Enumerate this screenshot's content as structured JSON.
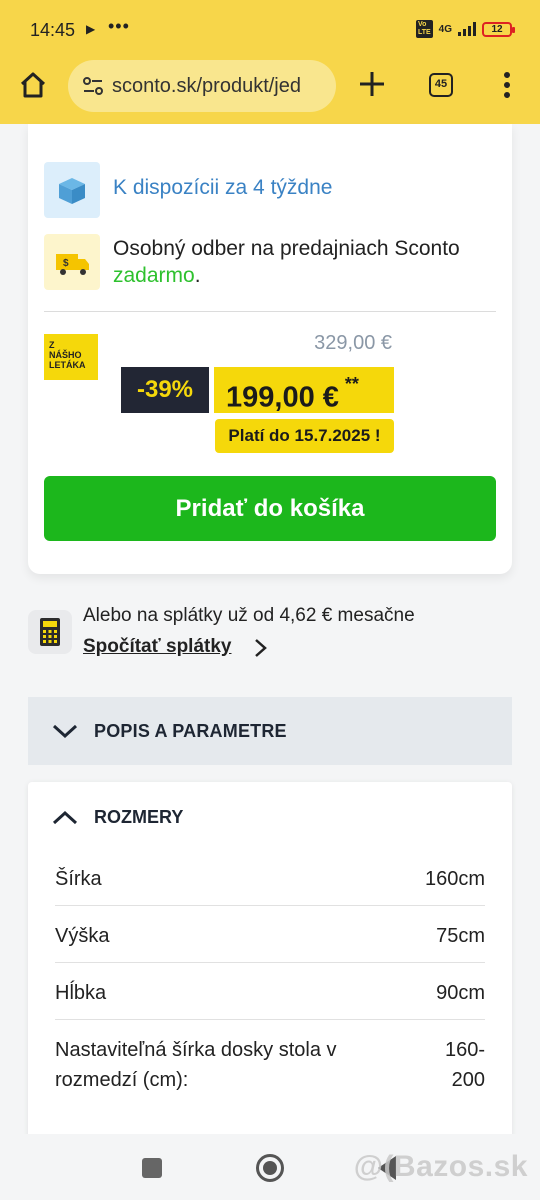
{
  "status": {
    "time": "14:45",
    "network": "4G",
    "battery": "12"
  },
  "browser": {
    "url": "sconto.sk/produkt/jed",
    "tab_count": "45"
  },
  "availability": {
    "text": "K dispozícii za 4 týždne"
  },
  "pickup": {
    "text_main": "Osobný odber na predajniach Sconto ",
    "text_free": "zadarmo",
    "text_end": "."
  },
  "pricing": {
    "flyer_label": [
      "Z",
      "NÁŠHO",
      "LETÁKA"
    ],
    "old_price": "329,00 €",
    "discount": "-39%",
    "new_price": "199,00 €",
    "new_price_mark": "**",
    "valid_until": "Platí do 15.7.2025 !"
  },
  "cart": {
    "button_label": "Pridať do košíka"
  },
  "installments": {
    "text": "Alebo na splátky už od 4,62 € mesačne",
    "link_label": "Spočítať splátky"
  },
  "accordion": {
    "title": "POPIS A PARAMETRE"
  },
  "dimensions": {
    "title": "ROZMERY",
    "rows": [
      {
        "label": "Šírka",
        "value": "160cm"
      },
      {
        "label": "Výška",
        "value": "75cm"
      },
      {
        "label": "Hĺbka",
        "value": "90cm"
      },
      {
        "label": "Nastaviteľná šírka dosky stola v rozmedzí (cm):",
        "value": "160-200"
      }
    ]
  },
  "watermark": "@(Bazos.sk",
  "colors": {
    "accent_yellow": "#f5d80b",
    "cart_green": "#1cb71c",
    "link_blue": "#3a82c4",
    "dark": "#222634"
  }
}
